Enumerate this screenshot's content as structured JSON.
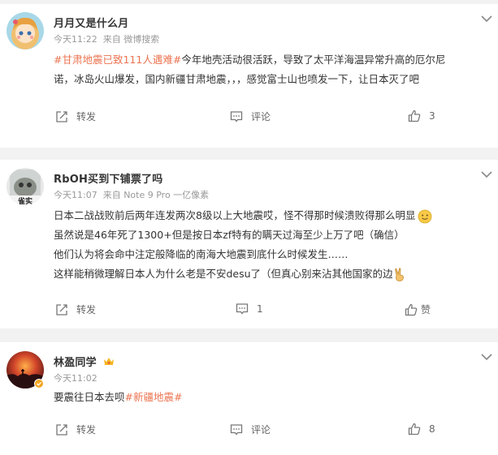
{
  "posts": [
    {
      "user": "月月又是什么月",
      "time": "今天11:22",
      "source": "来自 微博搜索",
      "lines": [
        {
          "tag": "#甘肃地震已致111人遇难#",
          "text": "今年地壳活动很活跃，导致了太平洋海温异常升高的厄尔尼"
        },
        {
          "tag": "",
          "text": "诺，冰岛火山爆发，国内新疆甘肃地震，，，感觉富士山也喷发一下，让日本灭了吧"
        }
      ],
      "actions": {
        "repost": "转发",
        "comment": "评论",
        "like": "3"
      }
    },
    {
      "user": "RbOH买到下铺票了吗",
      "time": "今天11:07",
      "source": "来自 Note 9 Pro 一亿像素",
      "avatar_label": "雀实",
      "lines": [
        {
          "tag": "",
          "text": "日本二战战败前后两年连发两次8级以上大地震哎，怪不得那时候溃败得那么明显"
        },
        {
          "tag": "",
          "text": "虽然说是46年死了1300+但是按日本zf特有的瞒天过海至少上万了吧（确信）"
        },
        {
          "tag": "",
          "text": "他们认为将会命中注定般降临的南海大地震到底什么时候发生……"
        },
        {
          "tag": "",
          "text": "这样能稍微理解日本人为什么老是不安desu了（但真心别来沾其他国家的边"
        }
      ],
      "actions": {
        "repost": "转发",
        "comment": "1",
        "like": "赞"
      }
    },
    {
      "user": "林盈同学",
      "time": "今天11:02",
      "source": "",
      "lines": [
        {
          "tag": "",
          "text": "要震往日本去呗",
          "tag_after": "#新疆地震#"
        }
      ],
      "actions": {
        "repost": "转发",
        "comment": "评论",
        "like": "8"
      }
    }
  ],
  "colors": {
    "accent": "#eb7350",
    "text": "#333333",
    "meta": "#999999",
    "background": "#f2f2f2"
  }
}
